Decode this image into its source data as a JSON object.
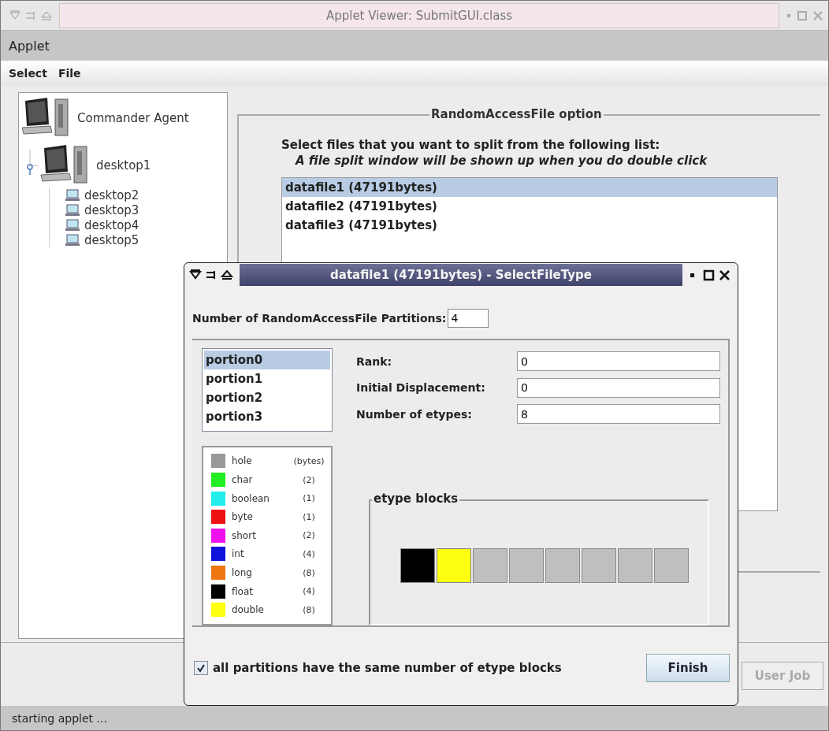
{
  "window": {
    "title": "Applet Viewer: SubmitGUI.class",
    "applet_menu": "Applet"
  },
  "menu": [
    "Select",
    "File"
  ],
  "tree": [
    {
      "label": "Commander Agent",
      "kind": "workstation",
      "children": [
        {
          "label": "desktop1",
          "kind": "workstation",
          "children": [
            {
              "label": "desktop2",
              "kind": "monitor"
            },
            {
              "label": "desktop3",
              "kind": "monitor"
            },
            {
              "label": "desktop4",
              "kind": "monitor"
            },
            {
              "label": "desktop5",
              "kind": "monitor"
            }
          ]
        }
      ]
    }
  ],
  "option_panel": {
    "title": "RandomAccessFile option",
    "instruction": "Select files that you want to split from the following list:",
    "hint": "A file split window will be shown up when you do double click",
    "files": [
      {
        "label": "datafile1 (47191bytes)",
        "selected": true
      },
      {
        "label": "datafile2 (47191bytes)",
        "selected": false
      },
      {
        "label": "datafile3 (47191bytes)",
        "selected": false
      }
    ]
  },
  "user_job_button": {
    "label": "User Job",
    "disabled": true
  },
  "status_bar": "starting applet ...",
  "dialog": {
    "title": "datafile1 (47191bytes) - SelectFileType",
    "partitions_label": "Number of RandomAccessFile Partitions:",
    "partitions_value": "4",
    "portions": [
      {
        "label": "portion0",
        "selected": true
      },
      {
        "label": "portion1",
        "selected": false
      },
      {
        "label": "portion2",
        "selected": false
      },
      {
        "label": "portion3",
        "selected": false
      }
    ],
    "fields": [
      {
        "label": "Rank:",
        "value": "0"
      },
      {
        "label": "Initial Displacement:",
        "value": "0"
      },
      {
        "label": "Number of etypes:",
        "value": "8"
      }
    ],
    "legend": [
      {
        "name": "hole",
        "size": "(bytes)",
        "color": "#999999"
      },
      {
        "name": "char",
        "size": "(2)",
        "color": "#22ee22"
      },
      {
        "name": "boolean",
        "size": "(1)",
        "color": "#22eeee"
      },
      {
        "name": "byte",
        "size": "(1)",
        "color": "#ee1111"
      },
      {
        "name": "short",
        "size": "(2)",
        "color": "#ee11ee"
      },
      {
        "name": "int",
        "size": "(4)",
        "color": "#1111dd"
      },
      {
        "name": "long",
        "size": "(8)",
        "color": "#ee7711"
      },
      {
        "name": "float",
        "size": "(4)",
        "color": "#000000"
      },
      {
        "name": "double",
        "size": "(8)",
        "color": "#ffff11"
      }
    ],
    "blocks_title": "etype blocks",
    "blocks": [
      {
        "color": "#000000"
      },
      {
        "color": "#ffff11"
      },
      {
        "color": "#c0bfc0"
      },
      {
        "color": "#c0bfc0"
      },
      {
        "color": "#c0bfc0"
      },
      {
        "color": "#c0bfc0"
      },
      {
        "color": "#c0bfc0"
      },
      {
        "color": "#c0bfc0"
      }
    ],
    "same_blocks": {
      "label": "all partitions have the same number of etype blocks",
      "checked": true
    },
    "finish_button": "Finish"
  }
}
